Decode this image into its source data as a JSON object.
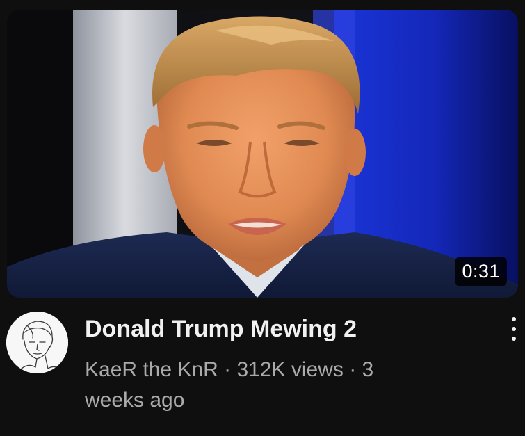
{
  "video": {
    "duration": "0:31",
    "title": "Donald Trump Mewing 2",
    "channel": "KaeR the KnR",
    "views": "312K views",
    "age_line1": "3",
    "age_line2": "weeks ago",
    "separator": " · "
  },
  "icons": {
    "more": "more-vert-icon",
    "avatar": "channel-avatar"
  }
}
